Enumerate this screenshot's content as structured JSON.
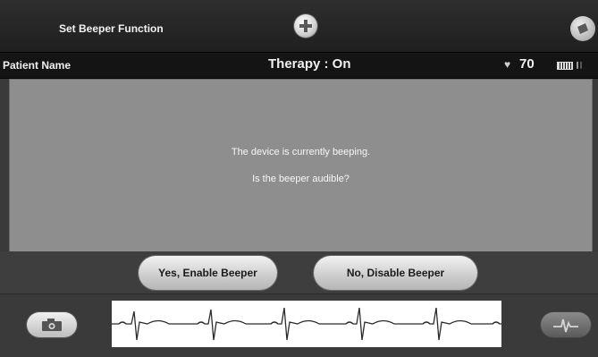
{
  "header": {
    "function_title": "Set Beeper Function"
  },
  "status_bar": {
    "patient_label": "Patient Name",
    "therapy_text": "Therapy : On",
    "heart_rate": "70",
    "heart_icon": "heart-icon",
    "battery_icon": "battery-icon",
    "telemetry_icon": "wireless-signal-icon"
  },
  "dialog": {
    "message": "The device is currently beeping.",
    "question": "Is the beeper audible?"
  },
  "actions": {
    "yes_label": "Yes, Enable Beeper",
    "no_label": "No, Disable Beeper"
  },
  "footer": {
    "camera_icon": "camera-icon",
    "marker_icon": "ecg-marker-icon"
  },
  "colors": {
    "dialog_background": "#8e8e8e",
    "status_bar_background": "#141414",
    "button_face": "#dcdcdc"
  }
}
